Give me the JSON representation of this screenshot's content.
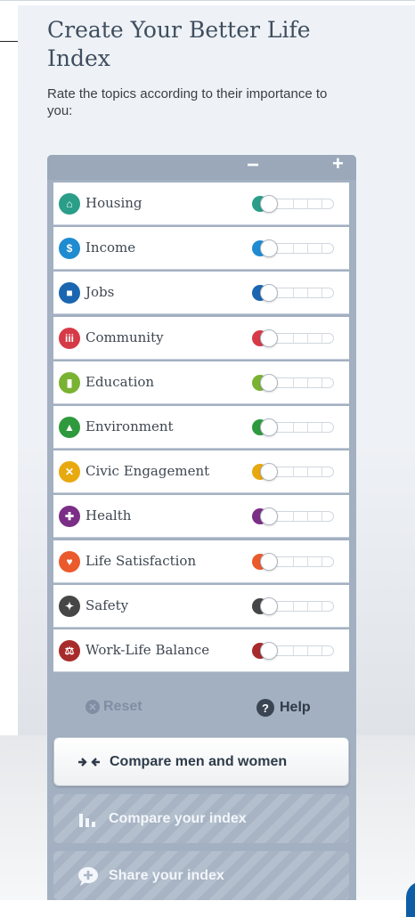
{
  "header": {
    "title": "Create Your Better Life Index",
    "subtitle": "Rate the topics according to their importance to you:"
  },
  "scale": {
    "minus": "−",
    "plus": "+"
  },
  "topics": [
    {
      "label": "Housing",
      "icon": "house-icon",
      "color": "#2a9e89",
      "rating": 0
    },
    {
      "label": "Income",
      "icon": "money-icon",
      "color": "#1f8bd1",
      "rating": 0
    },
    {
      "label": "Jobs",
      "icon": "briefcase-icon",
      "color": "#1b66b0",
      "rating": 0
    },
    {
      "label": "Community",
      "icon": "people-icon",
      "color": "#d63a47",
      "rating": 0
    },
    {
      "label": "Education",
      "icon": "book-icon",
      "color": "#7ab232",
      "rating": 0
    },
    {
      "label": "Environment",
      "icon": "tree-icon",
      "color": "#2e9a3d",
      "rating": 0
    },
    {
      "label": "Civic Engagement",
      "icon": "ballot-icon",
      "color": "#e8a90f",
      "rating": 0
    },
    {
      "label": "Health",
      "icon": "cross-icon",
      "color": "#7b2e86",
      "rating": 0
    },
    {
      "label": "Life Satisfaction",
      "icon": "heart-icon",
      "color": "#ea5a2c",
      "rating": 0
    },
    {
      "label": "Safety",
      "icon": "runner-icon",
      "color": "#464646",
      "rating": 0
    },
    {
      "label": "Work-Life Balance",
      "icon": "scales-icon",
      "color": "#a82b2b",
      "rating": 0
    }
  ],
  "controls": {
    "reset": "Reset",
    "help": "Help"
  },
  "buttons": {
    "compare": "Compare men and women",
    "compare_yours": "Compare your index",
    "share": "Share your index"
  }
}
